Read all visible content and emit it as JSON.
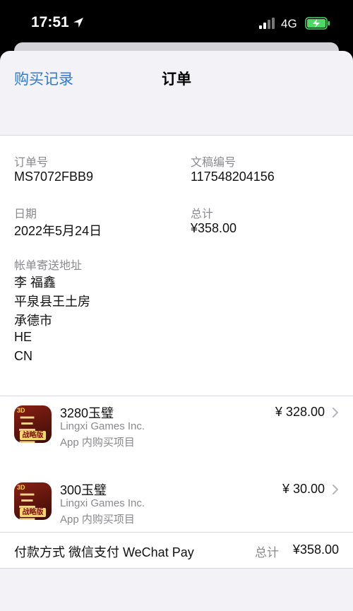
{
  "status_bar": {
    "time": "17:51",
    "network": "4G"
  },
  "nav": {
    "back_label": "购买记录",
    "title": "订单"
  },
  "order": {
    "order_no_label": "订单号",
    "order_no": "MS7072FBB9",
    "doc_no_label": "文稿编号",
    "doc_no": "117548204156",
    "date_label": "日期",
    "date": "2022年5月24日",
    "total_label": "总计",
    "total": "¥358.00",
    "address_label": "帐单寄送地址",
    "address_lines": [
      "李 福鑫",
      "平泉县王土房",
      "承德市",
      "HE",
      "CN"
    ]
  },
  "items": [
    {
      "name": "3280玉璧",
      "developer": "Lingxi Games Inc.",
      "type": "App 内购买项目",
      "price": "¥ 328.00",
      "icon_text": "三國志",
      "icon_badge": "3D",
      "icon_strip": "战略版"
    },
    {
      "name": "300玉璧",
      "developer": "Lingxi Games Inc.",
      "type": "App 内购买项目",
      "price": "¥ 30.00",
      "icon_text": "三國志",
      "icon_badge": "3D",
      "icon_strip": "战略版"
    }
  ],
  "payment": {
    "label": "付款方式 微信支付 WeChat Pay",
    "total_label": "总计",
    "total": "¥358.00"
  },
  "colors": {
    "accent": "#2f7ad6",
    "background": "#f2f2f7",
    "icon_red": "#8a2014",
    "battery_green": "#4cd964"
  }
}
